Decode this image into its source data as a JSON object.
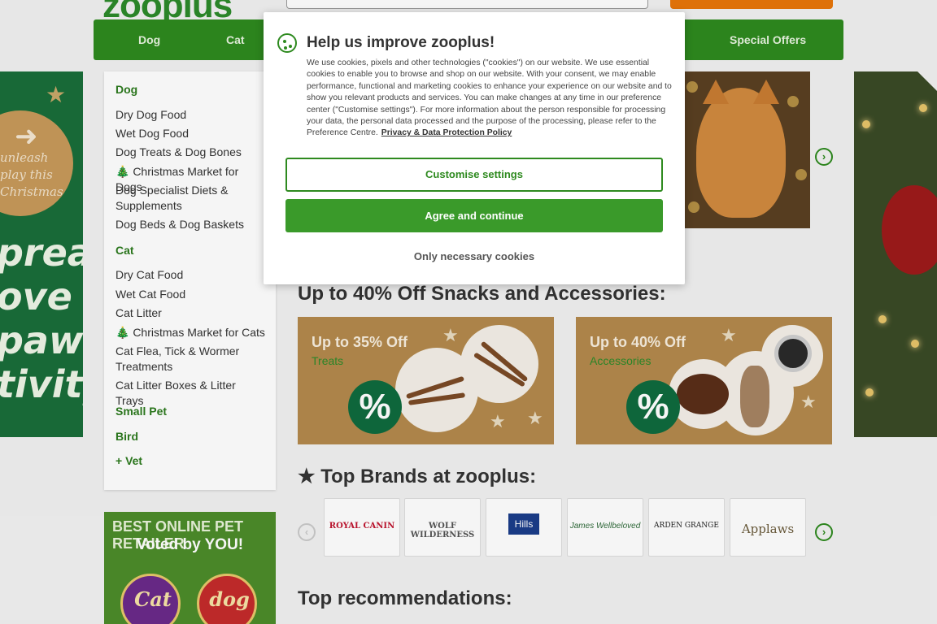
{
  "header": {
    "logo_text": "zooplus"
  },
  "nav": {
    "items": [
      "Dog",
      "Cat",
      "Special Offers"
    ]
  },
  "sidebar": {
    "sections": [
      {
        "title": "Dog",
        "links": [
          "Dry Dog Food",
          "Wet Dog Food",
          "Dog Treats & Dog Bones",
          "🎄 Christmas Market for Dogs",
          "Dog Specialist Diets & Supplements",
          "Dog Beds & Dog Baskets"
        ]
      },
      {
        "title": "Cat",
        "links": [
          "Dry Cat Food",
          "Wet Cat Food",
          "Cat Litter",
          "🎄 Christmas Market for Cats",
          "Cat Flea, Tick & Wormer Treatments",
          "Cat Litter Boxes & Litter Trays"
        ]
      }
    ],
    "extra": [
      "Small Pet",
      "Bird",
      "+ Vet"
    ]
  },
  "promo_left": {
    "script_text": "unleash\nplay this\nChristmas",
    "big_text": "pread\nove &\npaw-\ntivity"
  },
  "award": {
    "line1": "BEST ONLINE PET RETAILER",
    "line2": "Voted by YOU!",
    "seal1": "Cat",
    "seal2": "dog"
  },
  "sections": {
    "snacks_heading": "Up to 40% Off Snacks and Accessories:",
    "brands_heading": "Top Brands at zooplus:",
    "recommendations_heading": "Top recommendations:"
  },
  "deals": [
    {
      "title": "Up to 35% Off",
      "subtitle": "Treats",
      "badge": "%"
    },
    {
      "title": "Up to 40% Off",
      "subtitle": "Accessories",
      "badge": "%"
    }
  ],
  "brands": [
    "ROYAL CANIN",
    "WOLF WILDERNESS",
    "Hills",
    "James Wellbeloved",
    "ARDEN GRANGE",
    "Applaws"
  ],
  "modal": {
    "title": "Help us improve zooplus!",
    "body": "We use cookies, pixels and other technologies (\"cookies\") on our website. We use essential cookies to enable you to browse and shop on our website. With your consent, we may enable performance, functional and marketing cookies to enhance your experience on our website and to show you relevant products and services. You can make changes at any time in our preference center (\"Customise settings\"). For more information about the person responsible for processing your data, the personal data processed and the purpose of the processing, please refer to the Preference Centre.",
    "policy_link": "Privacy & Data Protection Policy",
    "customise_label": "Customise settings",
    "agree_label": "Agree and continue",
    "necessary_label": "Only necessary cookies"
  },
  "colors": {
    "brand_green": "#2e8a1f",
    "deal_tan": "#b3894c",
    "promo_dark_green": "#1a6e3a"
  }
}
